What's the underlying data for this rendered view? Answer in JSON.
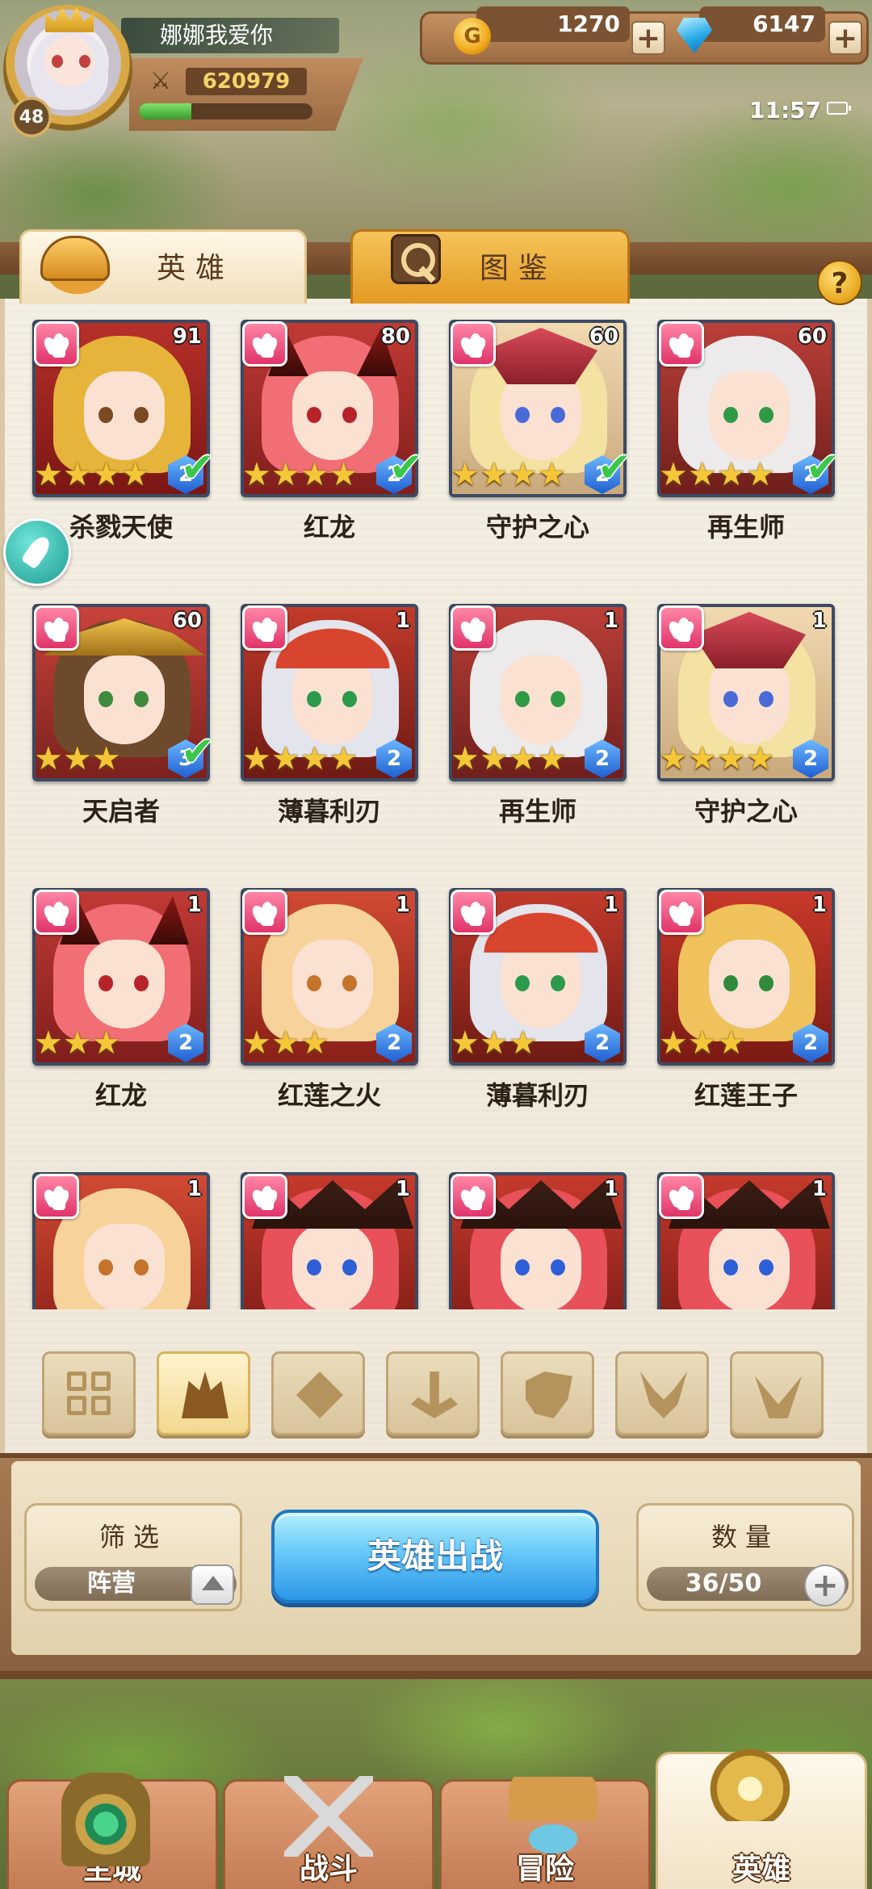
{
  "player": {
    "name": "娜娜我爱你",
    "level": "48",
    "power": "620979",
    "exp_fraction": 0.3
  },
  "currency": {
    "gold": "1270",
    "gems": "6147",
    "gold_symbol": "G"
  },
  "status": {
    "time": "11:57"
  },
  "tabs": {
    "heroes": "英雄",
    "codex": "图鉴"
  },
  "help": "?",
  "heroes": [
    {
      "name": "杀戮天使",
      "level": "91",
      "stars": "★★★★",
      "rank": "2",
      "deployed": true,
      "style": "blonde"
    },
    {
      "name": "红龙",
      "level": "80",
      "stars": "★★★★",
      "rank": "2",
      "deployed": true,
      "style": "dragon"
    },
    {
      "name": "守护之心",
      "level": "60",
      "stars": "★★★★",
      "rank": "2",
      "deployed": true,
      "style": "guardian"
    },
    {
      "name": "再生师",
      "level": "60",
      "stars": "★★★★",
      "rank": "2",
      "deployed": true,
      "style": "white"
    },
    {
      "name": "天启者",
      "level": "60",
      "stars": "★★★",
      "rank": "3",
      "deployed": true,
      "style": "brown"
    },
    {
      "name": "薄暮利刃",
      "level": "1",
      "stars": "★★★★",
      "rank": "2",
      "deployed": false,
      "style": "hood"
    },
    {
      "name": "再生师",
      "level": "1",
      "stars": "★★★★",
      "rank": "2",
      "deployed": false,
      "style": "white"
    },
    {
      "name": "守护之心",
      "level": "1",
      "stars": "★★★★",
      "rank": "2",
      "deployed": false,
      "style": "guardian"
    },
    {
      "name": "红龙",
      "level": "1",
      "stars": "★★★",
      "rank": "2",
      "deployed": false,
      "style": "dragon"
    },
    {
      "name": "红莲之火",
      "level": "1",
      "stars": "★★★",
      "rank": "2",
      "deployed": false,
      "style": "flame"
    },
    {
      "name": "薄暮利刃",
      "level": "1",
      "stars": "★★★",
      "rank": "2",
      "deployed": false,
      "style": "hood"
    },
    {
      "name": "红莲王子",
      "level": "1",
      "stars": "★★★",
      "rank": "2",
      "deployed": false,
      "style": "prince"
    },
    {
      "name": "",
      "level": "1",
      "stars": "",
      "rank": "",
      "deployed": false,
      "style": "flame"
    },
    {
      "name": "",
      "level": "1",
      "stars": "",
      "rank": "",
      "deployed": false,
      "style": "witch"
    },
    {
      "name": "",
      "level": "1",
      "stars": "",
      "rank": "",
      "deployed": false,
      "style": "witch"
    },
    {
      "name": "",
      "level": "1",
      "stars": "",
      "rank": "",
      "deployed": false,
      "style": "witch"
    }
  ],
  "filters": [
    {
      "icon": "grid-all-icon",
      "active": false
    },
    {
      "icon": "flame-faction-icon",
      "active": true
    },
    {
      "icon": "diamond-faction-icon",
      "active": false
    },
    {
      "icon": "anchor-faction-icon",
      "active": false
    },
    {
      "icon": "beast-faction-icon",
      "active": false
    },
    {
      "icon": "horn-faction-icon",
      "active": false
    },
    {
      "icon": "wing-faction-icon",
      "active": false
    }
  ],
  "bottom": {
    "filter_title": "筛选",
    "filter_value": "阵营",
    "deploy_label": "英雄出战",
    "count_title": "数量",
    "count_value": "36/50"
  },
  "nav": {
    "city": "主城",
    "battle": "战斗",
    "adventure": "冒险",
    "heroes": "英雄"
  },
  "colors": {
    "faction_flame": "#e0346a",
    "deploy_blue": "#2c97e8",
    "check_green": "#3ac74a",
    "star_gold": "#f5c738"
  }
}
